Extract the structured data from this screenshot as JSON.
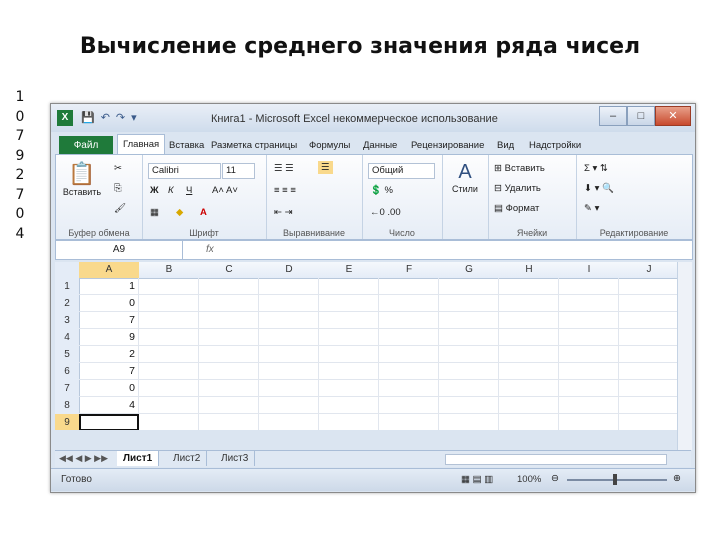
{
  "slide": {
    "title": "Вычисление среднего значения ряда чисел",
    "digits": [
      "1",
      "0",
      "7",
      "9",
      "2",
      "7",
      "0",
      "4"
    ]
  },
  "window": {
    "title": "Книга1 - Microsoft Excel некоммерческое использование",
    "minimize": "–",
    "maximize": "□",
    "close": "✕"
  },
  "ribbon_tabs": {
    "file": "Файл",
    "items": [
      "Главная",
      "Вставка",
      "Разметка страницы",
      "Формулы",
      "Данные",
      "Рецензирование",
      "Вид",
      "Надстройки"
    ],
    "active": "Главная"
  },
  "ribbon": {
    "paste": "Вставить",
    "font_name": "Calibri",
    "font_size": "11",
    "number_format": "Общий",
    "styles": "Стили",
    "insert": "Вставить",
    "delete": "Удалить",
    "format": "Формат",
    "groups": [
      "Буфер обмена",
      "Шрифт",
      "Выравнивание",
      "Число",
      "Ячейки",
      "Редактирование"
    ]
  },
  "formula_bar": {
    "name_box": "A9",
    "fx": "fx",
    "value": ""
  },
  "sheet": {
    "columns": [
      "A",
      "B",
      "C",
      "D",
      "E",
      "F",
      "G",
      "H",
      "I",
      "J"
    ],
    "rows": [
      "1",
      "2",
      "3",
      "4",
      "5",
      "6",
      "7",
      "8",
      "9"
    ],
    "column_a_values": [
      "1",
      "0",
      "7",
      "9",
      "2",
      "7",
      "0",
      "4",
      ""
    ],
    "active_cell": "A9",
    "tabs": [
      "Лист1",
      "Лист2",
      "Лист3"
    ],
    "active_tab": "Лист1"
  },
  "status": {
    "text": "Готово",
    "zoom": "100%"
  }
}
